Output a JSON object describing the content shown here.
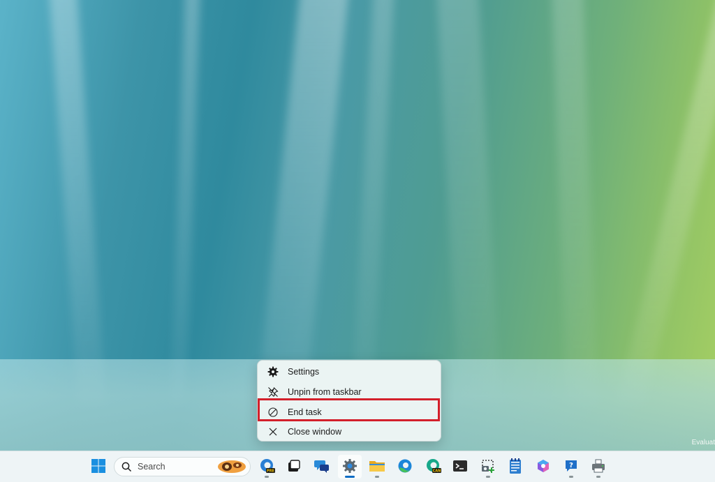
{
  "desktop": {
    "watermark": "Evaluat"
  },
  "context_menu": {
    "items": [
      {
        "label": "Settings",
        "icon": "gear-icon"
      },
      {
        "label": "Unpin from taskbar",
        "icon": "unpin-icon"
      },
      {
        "label": "End task",
        "icon": "end-task-icon"
      },
      {
        "label": "Close window",
        "icon": "close-icon"
      }
    ],
    "highlighted_item": "End task",
    "highlight_color": "#d3202b"
  },
  "taskbar": {
    "search_placeholder": "Search",
    "accent_color": "#0a6cc4",
    "apps": [
      {
        "name": "start",
        "icon": "windows-logo-icon"
      },
      {
        "name": "edge-preview",
        "icon": "edge-preview-icon",
        "badge": "PRE"
      },
      {
        "name": "task-view",
        "icon": "task-view-icon"
      },
      {
        "name": "chat",
        "icon": "chat-icon"
      },
      {
        "name": "settings",
        "icon": "settings-gear-icon",
        "active": true
      },
      {
        "name": "file-explorer",
        "icon": "folder-icon"
      },
      {
        "name": "edge",
        "icon": "edge-icon"
      },
      {
        "name": "edge-canary",
        "icon": "edge-canary-icon",
        "badge": "CAN"
      },
      {
        "name": "terminal",
        "icon": "terminal-icon"
      },
      {
        "name": "snipping-tool",
        "icon": "snipping-tool-icon"
      },
      {
        "name": "notepad",
        "icon": "notepad-icon"
      },
      {
        "name": "copilot",
        "icon": "copilot-icon"
      },
      {
        "name": "get-help",
        "icon": "help-icon"
      },
      {
        "name": "printer",
        "icon": "printer-icon"
      }
    ]
  }
}
